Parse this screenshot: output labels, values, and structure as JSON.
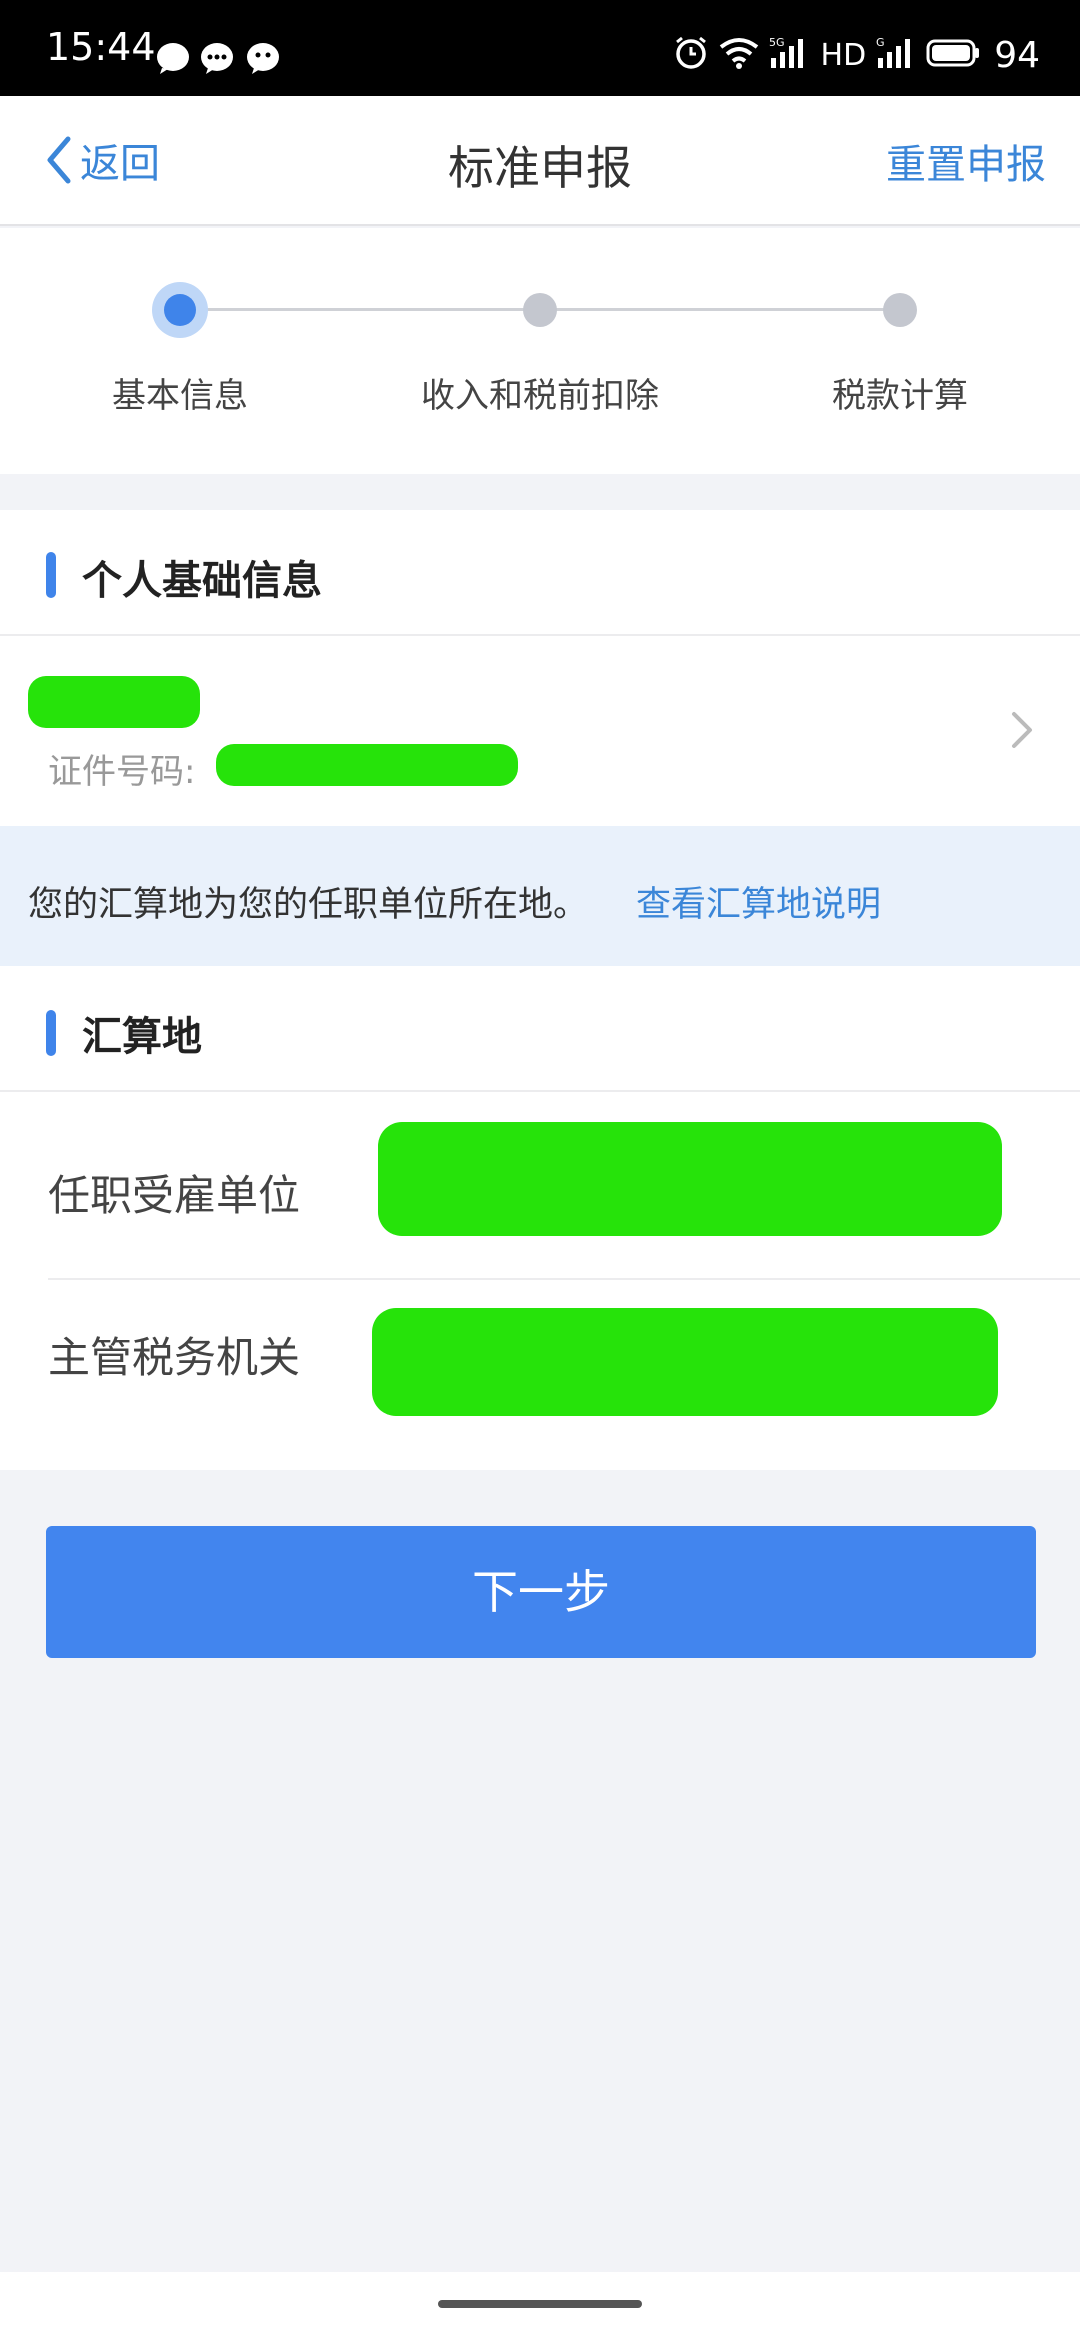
{
  "status_bar": {
    "time": "15:44",
    "network_label": "HD",
    "battery": "94"
  },
  "nav": {
    "back_label": "返回",
    "title": "标准申报",
    "reset_label": "重置申报"
  },
  "stepper": {
    "steps": [
      {
        "label": "基本信息",
        "active": true
      },
      {
        "label": "收入和税前扣除",
        "active": false
      },
      {
        "label": "税款计算",
        "active": false
      }
    ]
  },
  "personal_section": {
    "title": "个人基础信息",
    "id_label": "证件号码:"
  },
  "info_banner": {
    "text": "您的汇算地为您的任职单位所在地。",
    "link": "查看汇算地说明"
  },
  "settlement_section": {
    "title": "汇算地",
    "fields": [
      {
        "label": "任职受雇单位"
      },
      {
        "label": "主管税务机关"
      }
    ]
  },
  "next_button": "下一步",
  "colors": {
    "accent": "#3f84ea",
    "link": "#3b86d8",
    "redaction": "#26e30a"
  }
}
